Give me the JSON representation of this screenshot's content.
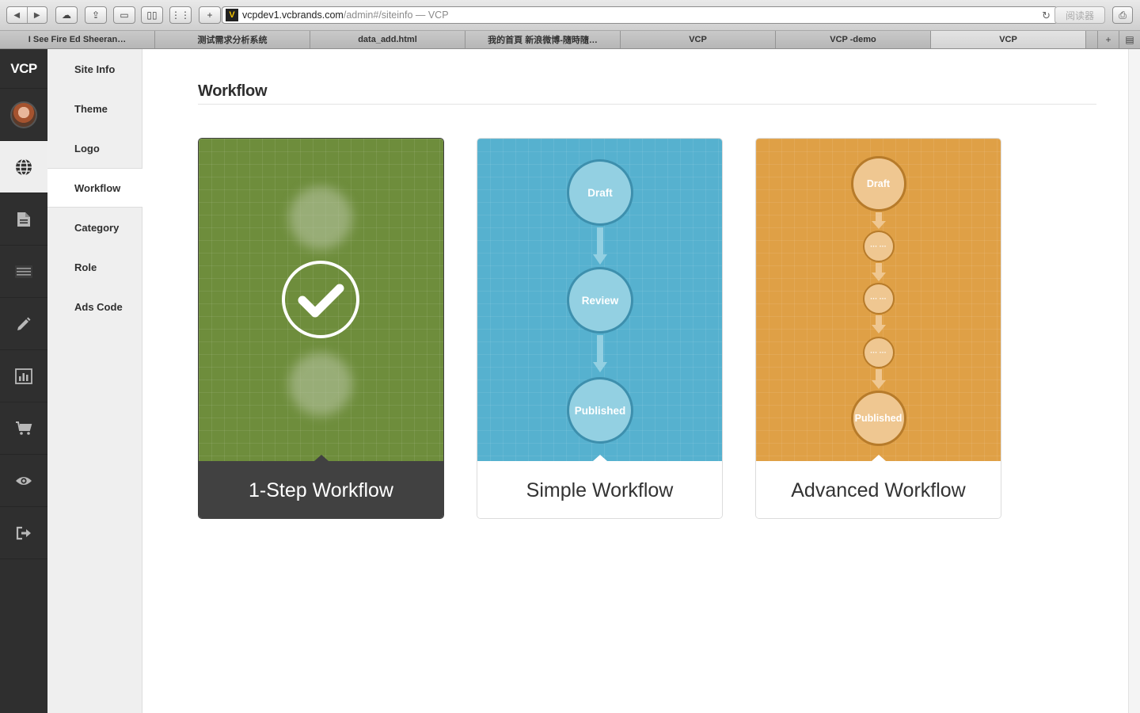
{
  "browser": {
    "url_host": "vcpdev1.vcbrands.com",
    "url_path": "/admin#/siteinfo — VCP",
    "reader_label": "阅读器",
    "tabs": [
      {
        "label": "I See Fire Ed Sheeran…",
        "active": false
      },
      {
        "label": "测试需求分析系统",
        "active": false
      },
      {
        "label": "data_add.html",
        "active": false
      },
      {
        "label": "我的首頁 新浪微博-隨時隨…",
        "active": false
      },
      {
        "label": "VCP",
        "active": false
      },
      {
        "label": "VCP -demo",
        "active": false
      },
      {
        "label": "VCP",
        "active": true
      }
    ]
  },
  "rail": {
    "logo": "VCP",
    "items": [
      {
        "icon": "avatar"
      },
      {
        "icon": "globe-icon",
        "active": true
      },
      {
        "icon": "document-icon"
      },
      {
        "icon": "list-icon"
      },
      {
        "icon": "pencil-icon"
      },
      {
        "icon": "bar-chart-icon"
      },
      {
        "icon": "cart-icon"
      },
      {
        "icon": "eye-icon"
      },
      {
        "icon": "logout-icon"
      }
    ]
  },
  "subnav": {
    "items": [
      {
        "label": "Site Info"
      },
      {
        "label": "Theme"
      },
      {
        "label": "Logo"
      },
      {
        "label": "Workflow",
        "active": true
      },
      {
        "label": "Category"
      },
      {
        "label": "Role"
      },
      {
        "label": "Ads Code"
      }
    ]
  },
  "main": {
    "title": "Workflow",
    "cards": [
      {
        "label": "1-Step Workflow",
        "selected": true,
        "color": "#6e8d3c"
      },
      {
        "label": "Simple Workflow",
        "selected": false,
        "color": "#56b1cf",
        "nodes": [
          "Draft",
          "Review",
          "Published"
        ]
      },
      {
        "label": "Advanced Workflow",
        "selected": false,
        "color": "#dfa046",
        "nodes": [
          "Draft",
          "··· ···",
          "··· ···",
          "··· ···",
          "Published"
        ]
      }
    ]
  }
}
